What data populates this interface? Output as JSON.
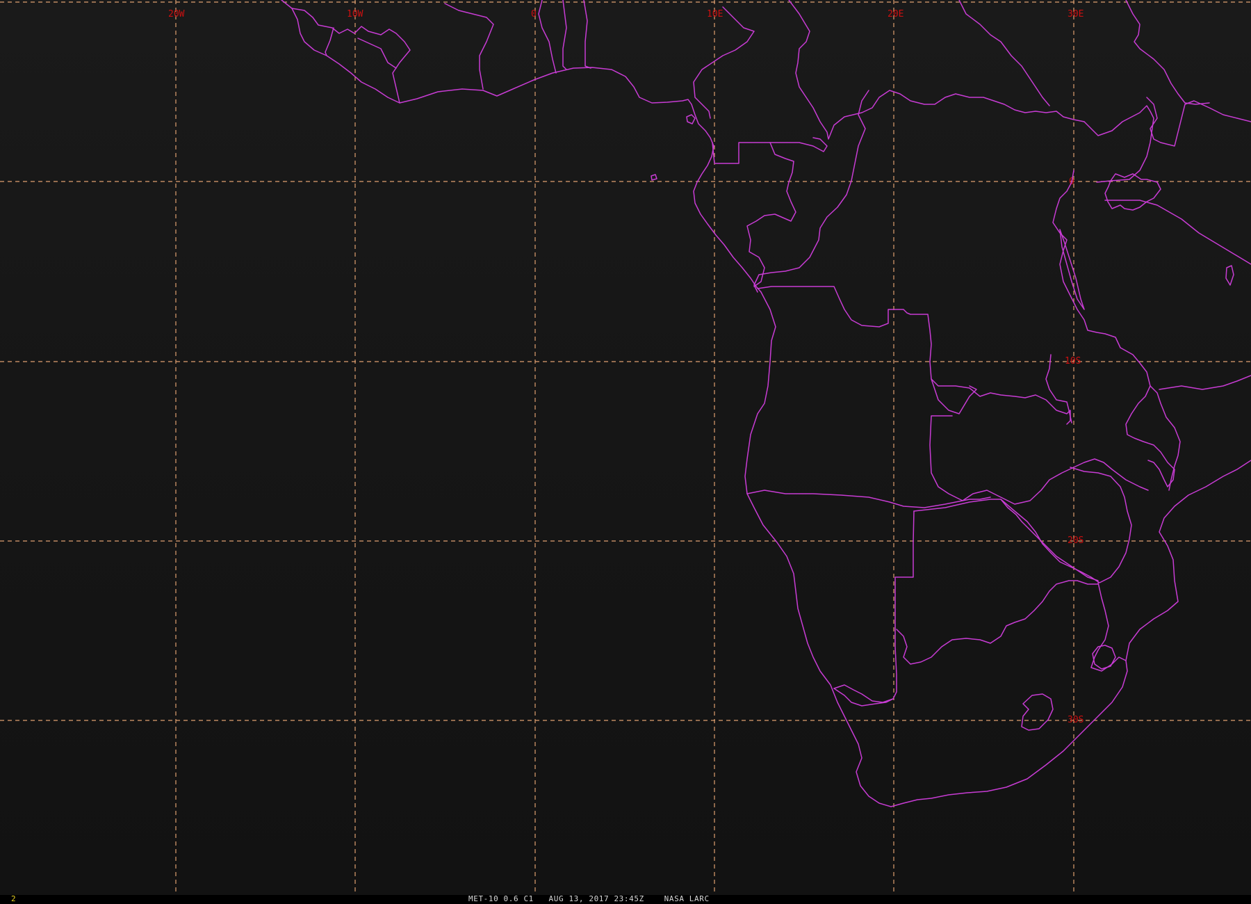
{
  "footer": {
    "frame_number": "2",
    "caption": "MET-10 0.6 C1   AUG 13, 2017 23:45Z    NASA LARC"
  },
  "grid": {
    "longitude_labels": [
      "20W",
      "10W",
      "0",
      "10E",
      "20E",
      "30E"
    ],
    "latitude_labels": [
      "0",
      "10S",
      "20S",
      "30S"
    ]
  },
  "colors": {
    "background": "#121212",
    "grid_lines": "#e0a070",
    "grid_labels": "#cc1010",
    "borders": "#c83cd4",
    "frame_number": "#e6d020",
    "caption": "#d8d8d8"
  }
}
